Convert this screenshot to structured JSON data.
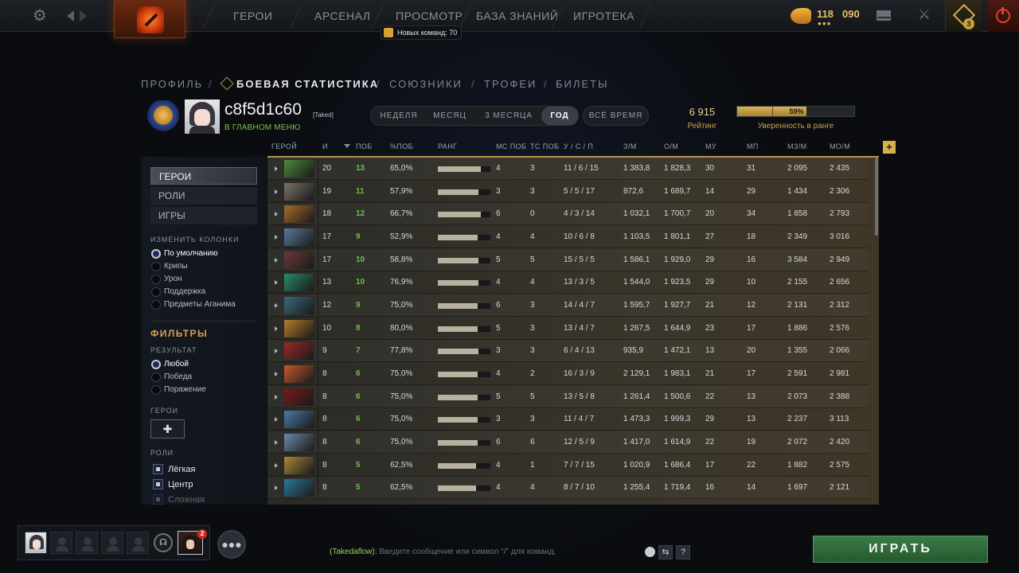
{
  "topbar": {
    "nav": [
      "ГЕРОИ",
      "АРСЕНАЛ",
      "ПРОСМОТР",
      "БАЗА ЗНАНИЙ",
      "ИГРОТЕКА"
    ],
    "notification": "Новых команд: 70",
    "shards": "118",
    "shards_dots": "●●●",
    "gold": "090",
    "plus_badge": "3"
  },
  "profile_nav": {
    "items": [
      "ПРОФИЛЬ",
      "БОЕВАЯ СТАТИСТИКА",
      "СОЮЗНИКИ",
      "ТРОФЕИ",
      "БИЛЕТЫ"
    ],
    "active": "БОЕВАЯ СТАТИСТИКА"
  },
  "player": {
    "name": "c8f5d1c60",
    "tag": "[Taked]",
    "status": "В ГЛАВНОМ МЕНЮ"
  },
  "periods": {
    "options": [
      "НЕДЕЛЯ",
      "МЕСЯЦ",
      "3 МЕСЯЦА",
      "ГОД"
    ],
    "active": "ГОД",
    "all_time": "ВСЁ ВРЕМЯ"
  },
  "rating": {
    "value": "6 915",
    "label": "Рейтинг"
  },
  "confidence": {
    "percent": 59,
    "text": "59%",
    "label": "Уверенность в ранге"
  },
  "left_panel": {
    "tabs": [
      "ГЕРОИ",
      "РОЛИ",
      "ИГРЫ"
    ],
    "active_tab": "ГЕРОИ",
    "columns_title": "ИЗМЕНИТЬ КОЛОНКИ",
    "column_options": [
      "По умолчанию",
      "Крипы",
      "Урон",
      "Поддержка",
      "Предметы Аганима"
    ],
    "filters_title": "ФИЛЬТРЫ",
    "result_title": "РЕЗУЛЬТАТ",
    "result_options": [
      "Любой",
      "Победа",
      "Поражение"
    ],
    "heroes_title": "ГЕРОИ",
    "add_hero": "✚",
    "roles_title": "РОЛИ",
    "roles": [
      "Лёгкая",
      "Центр",
      "Сложная"
    ]
  },
  "table": {
    "headers": [
      "ГЕРОЙ",
      "И",
      "ПОБ",
      "%ПОБ",
      "РАНГ",
      "МС ПОБ",
      "ТС ПОБ",
      "У / С / П",
      "З/М",
      "О/М",
      "МУ",
      "МП",
      "МЗ/М",
      "МО/М"
    ],
    "add_column": "+",
    "rows": [
      {
        "hero_color": "#4e8a3a",
        "games": "20",
        "wins": "13",
        "winrate": "65,0%",
        "rank": 0.82,
        "ms": "4",
        "ts": "3",
        "kda": "11 / 6 / 15",
        "gpm": "1 383,8",
        "xpm": "1 828,3",
        "mu": "30",
        "mp": "31",
        "mgpm": "2 095",
        "mxpm": "2 435"
      },
      {
        "hero_color": "#7a7268",
        "games": "19",
        "wins": "11",
        "winrate": "57,9%",
        "rank": 0.78,
        "ms": "3",
        "ts": "3",
        "kda": "5 / 5 / 17",
        "gpm": "872,6",
        "xpm": "1 689,7",
        "mu": "14",
        "mp": "29",
        "mgpm": "1 434",
        "mxpm": "2 306"
      },
      {
        "hero_color": "#a86a2a",
        "games": "18",
        "wins": "12",
        "winrate": "66,7%",
        "rank": 0.82,
        "ms": "6",
        "ts": "0",
        "kda": "4 / 3 / 14",
        "gpm": "1 032,1",
        "xpm": "1 700,7",
        "mu": "20",
        "mp": "34",
        "mgpm": "1 858",
        "mxpm": "2 793"
      },
      {
        "hero_color": "#5a7a9a",
        "games": "17",
        "wins": "9",
        "winrate": "52,9%",
        "rank": 0.76,
        "ms": "4",
        "ts": "4",
        "kda": "10 / 6 / 8",
        "gpm": "1 103,5",
        "xpm": "1 801,1",
        "mu": "27",
        "mp": "18",
        "mgpm": "2 349",
        "mxpm": "3 016"
      },
      {
        "hero_color": "#6a3a3a",
        "games": "17",
        "wins": "10",
        "winrate": "58,8%",
        "rank": 0.78,
        "ms": "5",
        "ts": "5",
        "kda": "15 / 5 / 5",
        "gpm": "1 586,1",
        "xpm": "1 929,0",
        "mu": "29",
        "mp": "16",
        "mgpm": "3 584",
        "mxpm": "2 949"
      },
      {
        "hero_color": "#2a8a6a",
        "games": "13",
        "wins": "10",
        "winrate": "76,9%",
        "rank": 0.78,
        "ms": "4",
        "ts": "4",
        "kda": "13 / 3 / 5",
        "gpm": "1 544,0",
        "xpm": "1 923,5",
        "mu": "29",
        "mp": "10",
        "mgpm": "2 155",
        "mxpm": "2 656"
      },
      {
        "hero_color": "#3a6a7a",
        "games": "12",
        "wins": "9",
        "winrate": "75,0%",
        "rank": 0.76,
        "ms": "6",
        "ts": "3",
        "kda": "14 / 4 / 7",
        "gpm": "1 595,7",
        "xpm": "1 927,7",
        "mu": "21",
        "mp": "12",
        "mgpm": "2 131",
        "mxpm": "2 312"
      },
      {
        "hero_color": "#b87a2a",
        "games": "10",
        "wins": "8",
        "winrate": "80,0%",
        "rank": 0.76,
        "ms": "5",
        "ts": "3",
        "kda": "13 / 4 / 7",
        "gpm": "1 267,5",
        "xpm": "1 644,9",
        "mu": "23",
        "mp": "17",
        "mgpm": "1 886",
        "mxpm": "2 576"
      },
      {
        "hero_color": "#9a2a2a",
        "games": "9",
        "wins": "7",
        "winrate": "77,8%",
        "rank": 0.78,
        "ms": "3",
        "ts": "3",
        "kda": "6 / 4 / 13",
        "gpm": "935,9",
        "xpm": "1 472,1",
        "mu": "13",
        "mp": "20",
        "mgpm": "1 355",
        "mxpm": "2 066"
      },
      {
        "hero_color": "#c8582a",
        "games": "8",
        "wins": "6",
        "winrate": "75,0%",
        "rank": 0.76,
        "ms": "4",
        "ts": "2",
        "kda": "16 / 3 / 9",
        "gpm": "2 129,1",
        "xpm": "1 983,1",
        "mu": "21",
        "mp": "17",
        "mgpm": "2 591",
        "mxpm": "2 981"
      },
      {
        "hero_color": "#7a1a1a",
        "games": "8",
        "wins": "6",
        "winrate": "75,0%",
        "rank": 0.76,
        "ms": "5",
        "ts": "5",
        "kda": "13 / 5 / 8",
        "gpm": "1 261,4",
        "xpm": "1 500,6",
        "mu": "22",
        "mp": "13",
        "mgpm": "2 073",
        "mxpm": "2 388"
      },
      {
        "hero_color": "#4a7aa8",
        "games": "8",
        "wins": "6",
        "winrate": "75,0%",
        "rank": 0.76,
        "ms": "3",
        "ts": "3",
        "kda": "11 / 4 / 7",
        "gpm": "1 473,3",
        "xpm": "1 999,3",
        "mu": "29",
        "mp": "13",
        "mgpm": "2 237",
        "mxpm": "3 113"
      },
      {
        "hero_color": "#6a8aa8",
        "games": "8",
        "wins": "6",
        "winrate": "75,0%",
        "rank": 0.76,
        "ms": "6",
        "ts": "6",
        "kda": "12 / 5 / 9",
        "gpm": "1 417,0",
        "xpm": "1 614,9",
        "mu": "22",
        "mp": "19",
        "mgpm": "2 072",
        "mxpm": "2 420"
      },
      {
        "hero_color": "#a8883a",
        "games": "8",
        "wins": "5",
        "winrate": "62,5%",
        "rank": 0.73,
        "ms": "4",
        "ts": "1",
        "kda": "7 / 7 / 15",
        "gpm": "1 020,9",
        "xpm": "1 686,4",
        "mu": "17",
        "mp": "22",
        "mgpm": "1 882",
        "mxpm": "2 575"
      },
      {
        "hero_color": "#2a7a9a",
        "games": "8",
        "wins": "5",
        "winrate": "62,5%",
        "rank": 0.73,
        "ms": "4",
        "ts": "4",
        "kda": "8 / 7 / 10",
        "gpm": "1 255,4",
        "xpm": "1 719,4",
        "mu": "16",
        "mp": "14",
        "mgpm": "1 697",
        "mxpm": "2 121"
      }
    ]
  },
  "bottom": {
    "friend_badge": "2",
    "chat_channel": "(Takedaflow):",
    "chat_placeholder": "Введите сообщение или символ \"/\" для команд.",
    "chat_help": "?",
    "play": "ИГРАТЬ"
  },
  "colors": {
    "win_green": "#6cc04a",
    "gold_accent": "#d8b04a",
    "play_green": "#2f6b3a"
  }
}
